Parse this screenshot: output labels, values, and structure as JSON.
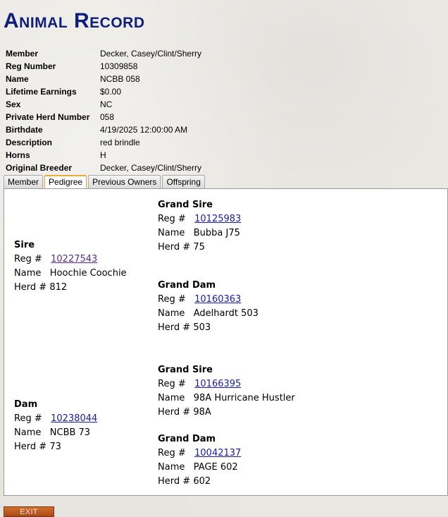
{
  "page": {
    "title": "Animal Record"
  },
  "info": [
    {
      "label": "Member",
      "value": "Decker, Casey/Clint/Sherry"
    },
    {
      "label": "Reg Number",
      "value": "10309858"
    },
    {
      "label": "Name",
      "value": "NCBB 058"
    },
    {
      "label": "Lifetime Earnings",
      "value": "$0.00"
    },
    {
      "label": "Sex",
      "value": "NC"
    },
    {
      "label": "Private Herd Number",
      "value": "058"
    },
    {
      "label": "Birthdate",
      "value": "4/19/2025 12:00:00 AM"
    },
    {
      "label": "Description",
      "value": "red brindle"
    },
    {
      "label": "Horns",
      "value": "H"
    },
    {
      "label": "Original Breeder",
      "value": "Decker, Casey/Clint/Sherry"
    }
  ],
  "tabs": [
    {
      "label": "Member",
      "active": false
    },
    {
      "label": "Pedigree",
      "active": true
    },
    {
      "label": "Previous Owners",
      "active": false
    },
    {
      "label": "Offspring",
      "active": false
    }
  ],
  "pedigree": {
    "labels": {
      "reg": "Reg #",
      "name": "Name",
      "herd": "Herd #"
    },
    "sire": {
      "title": "Sire",
      "reg": "10227543",
      "name": "Hoochie Coochie",
      "herd": "812"
    },
    "sire_grand_sire": {
      "title": "Grand Sire",
      "reg": "10125983",
      "name": "Bubba J75",
      "herd": "75"
    },
    "sire_grand_dam": {
      "title": "Grand Dam",
      "reg": "10160363",
      "name": "Adelhardt 503",
      "herd": "503"
    },
    "dam": {
      "title": "Dam",
      "reg": "10238044",
      "name": "NCBB 73",
      "herd": "73"
    },
    "dam_grand_sire": {
      "title": "Grand Sire",
      "reg": "10166395",
      "name": "98A Hurricane Hustler",
      "herd": "98A"
    },
    "dam_grand_dam": {
      "title": "Grand Dam",
      "reg": "10042137",
      "name": "PAGE 602",
      "herd": "602"
    }
  },
  "buttons": {
    "exit": "EXIT"
  },
  "colors": {
    "title": "#0d1f7a",
    "link": "#1a1aa6",
    "visited_link": "#5a2a8a",
    "active_tab_border": "#f0a836",
    "exit_button": "#c0602a"
  }
}
